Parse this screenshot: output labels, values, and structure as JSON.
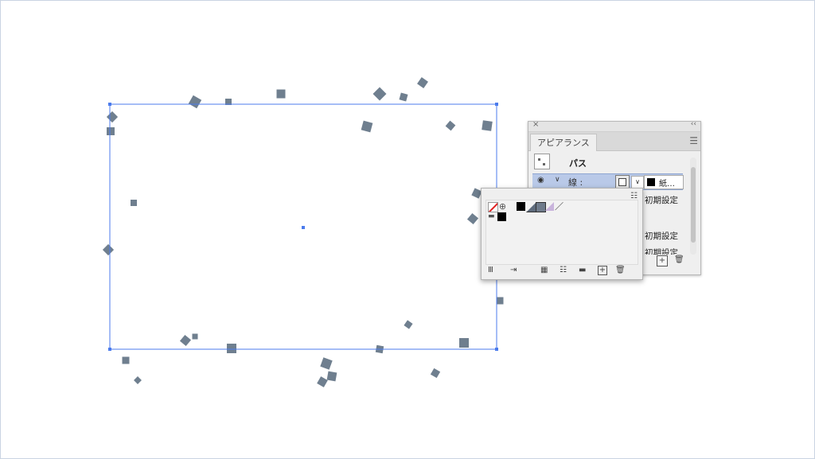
{
  "appearance_panel": {
    "tab_label": "アピアランス",
    "target_label": "パス",
    "stroke_label": "線 :",
    "stroke_weight_label": "紙…",
    "row_default_1": "初期設定",
    "row_default_2": "初期設定",
    "row_default_3": "初期設定"
  },
  "icons": {
    "close": "×",
    "collapse": "‹‹",
    "menu": "☰",
    "eye": "◉",
    "chevron": "∨",
    "dropdown": "∨",
    "list_view": "☷",
    "registration": "⊕",
    "line": "／",
    "folder": "▬",
    "library": "Ⅲ",
    "place": "⇥",
    "swatch_options": "▦",
    "new_folder": "▬",
    "new": "+",
    "trash": "🗑"
  },
  "colors": {
    "selection_blue": "#4b7bec",
    "shape_fill": "#6f7f8f",
    "stroke_row_highlight": "#b9c9e8"
  }
}
